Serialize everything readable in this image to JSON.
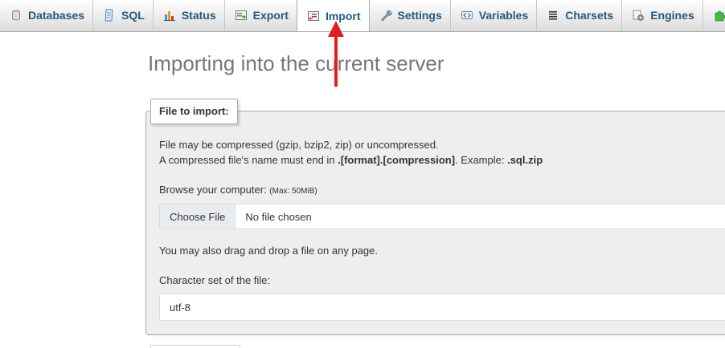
{
  "tabs": [
    {
      "id": "databases",
      "label": "Databases",
      "icon": "database-icon",
      "active": false
    },
    {
      "id": "sql",
      "label": "SQL",
      "icon": "sql-icon",
      "active": false
    },
    {
      "id": "status",
      "label": "Status",
      "icon": "status-chart-icon",
      "active": false
    },
    {
      "id": "export",
      "label": "Export",
      "icon": "export-icon",
      "active": false
    },
    {
      "id": "import",
      "label": "Import",
      "icon": "import-icon",
      "active": true
    },
    {
      "id": "settings",
      "label": "Settings",
      "icon": "wrench-icon",
      "active": false
    },
    {
      "id": "variables",
      "label": "Variables",
      "icon": "variables-icon",
      "active": false
    },
    {
      "id": "charsets",
      "label": "Charsets",
      "icon": "charsets-icon",
      "active": false
    },
    {
      "id": "engines",
      "label": "Engines",
      "icon": "engines-icon",
      "active": false
    },
    {
      "id": "plugins",
      "label": "",
      "icon": "plugin-puzzle-icon",
      "active": false
    }
  ],
  "page": {
    "title": "Importing into the current server"
  },
  "file_import": {
    "legend": "File to import:",
    "compression_note": "File may be compressed (gzip, bzip2, zip) or uncompressed.",
    "filename_note_prefix": "A compressed file's name must end in ",
    "filename_note_format": ".[format].[compression]",
    "filename_note_middle": ". Example: ",
    "filename_note_example": ".sql.zip",
    "browse_label": "Browse your computer: ",
    "max_size": "(Max: 50MiB)",
    "choose_button": "Choose File",
    "file_status": "No file chosen",
    "drag_drop_note": "You may also drag and drop a file on any page.",
    "charset_label": "Character set of the file:",
    "charset_value": "utf-8"
  },
  "colors": {
    "tab_text": "#235a81",
    "annotation_arrow": "#e02020",
    "fieldset_bg": "#eeeeee"
  }
}
